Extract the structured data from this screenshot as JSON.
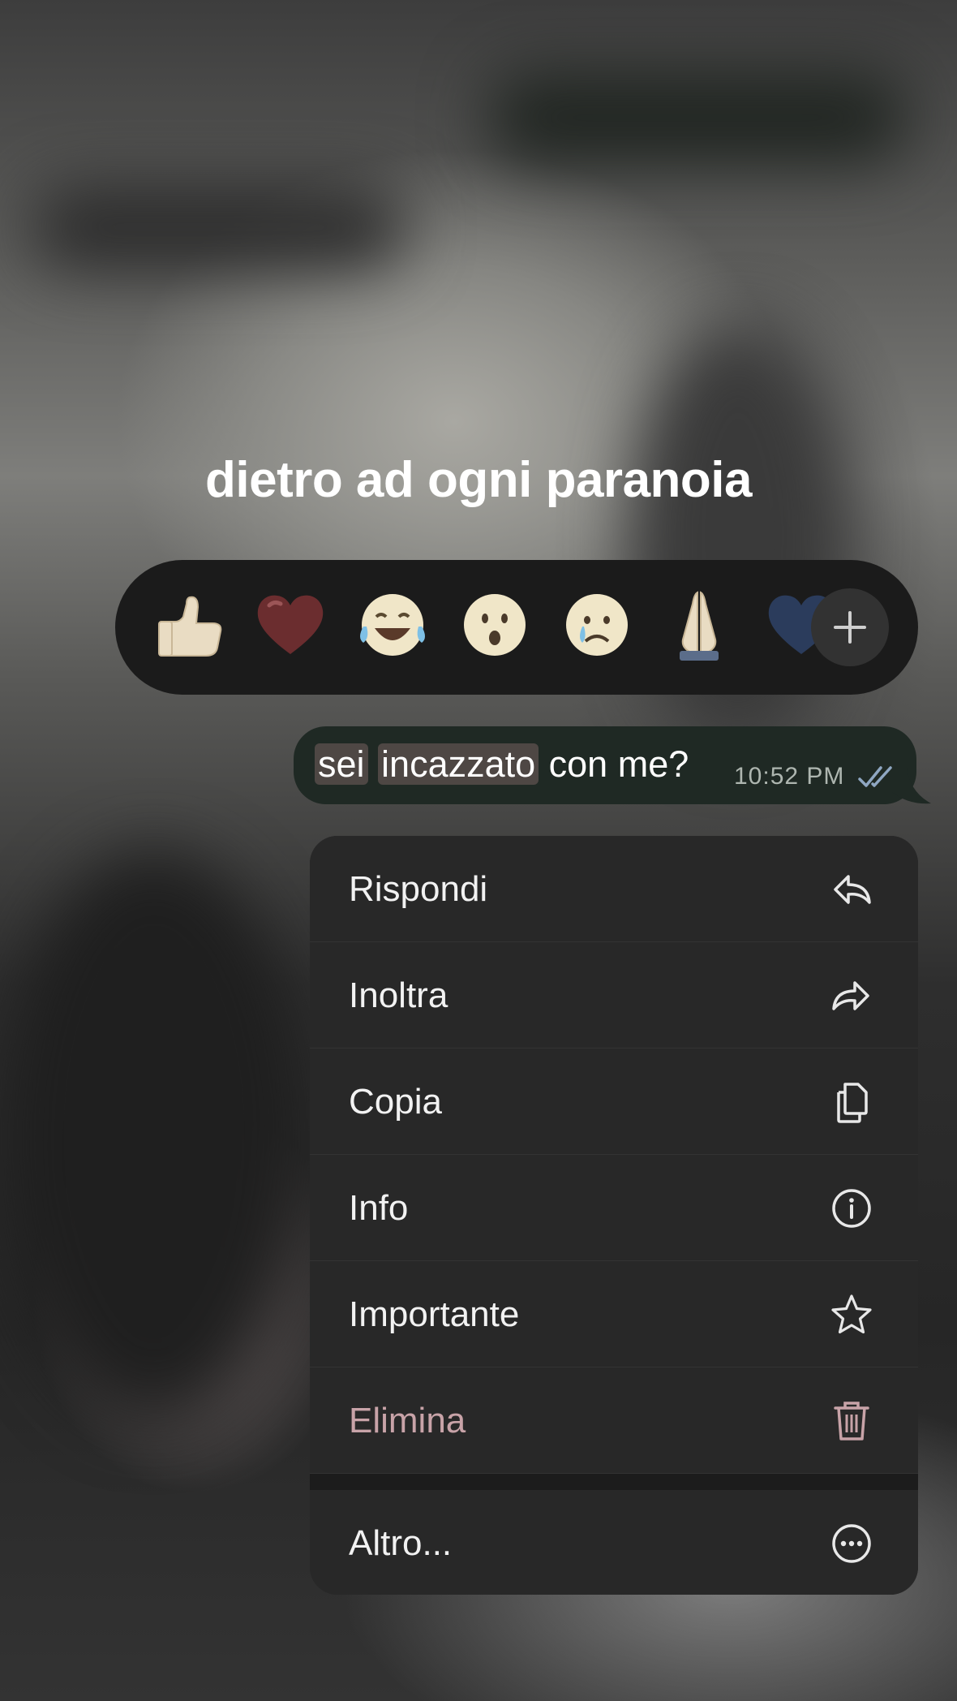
{
  "caption": "dietro ad ogni paranoia",
  "reactions": {
    "emojis": [
      {
        "icon": "thumbs-up-icon",
        "char": "👍"
      },
      {
        "icon": "heart-icon",
        "char": "❤️"
      },
      {
        "icon": "tears-of-joy-icon",
        "char": "😂"
      },
      {
        "icon": "surprised-face-icon",
        "char": "😮"
      },
      {
        "icon": "crying-face-icon",
        "char": "😢"
      },
      {
        "icon": "folded-hands-icon",
        "char": "🙏"
      },
      {
        "icon": "blue-heart-icon",
        "char": "💙"
      }
    ],
    "add_icon": "plus-icon"
  },
  "message": {
    "word1": "sei",
    "word2": "incazzato",
    "rest": " con me?",
    "time": "10:52 PM",
    "status_icon": "double-check-icon",
    "colors": {
      "bubble": "#1f2924",
      "highlight": "#4e4744",
      "ticks": "#8fa7c2"
    }
  },
  "menu": {
    "items": [
      {
        "label": "Rispondi",
        "icon": "reply-icon"
      },
      {
        "label": "Inoltra",
        "icon": "forward-icon"
      },
      {
        "label": "Copia",
        "icon": "copy-icon"
      },
      {
        "label": "Info",
        "icon": "info-icon"
      },
      {
        "label": "Importante",
        "icon": "star-icon"
      },
      {
        "label": "Elimina",
        "icon": "trash-icon",
        "color": "#c8a3a8"
      },
      {
        "label": "Altro...",
        "icon": "more-icon"
      }
    ]
  }
}
